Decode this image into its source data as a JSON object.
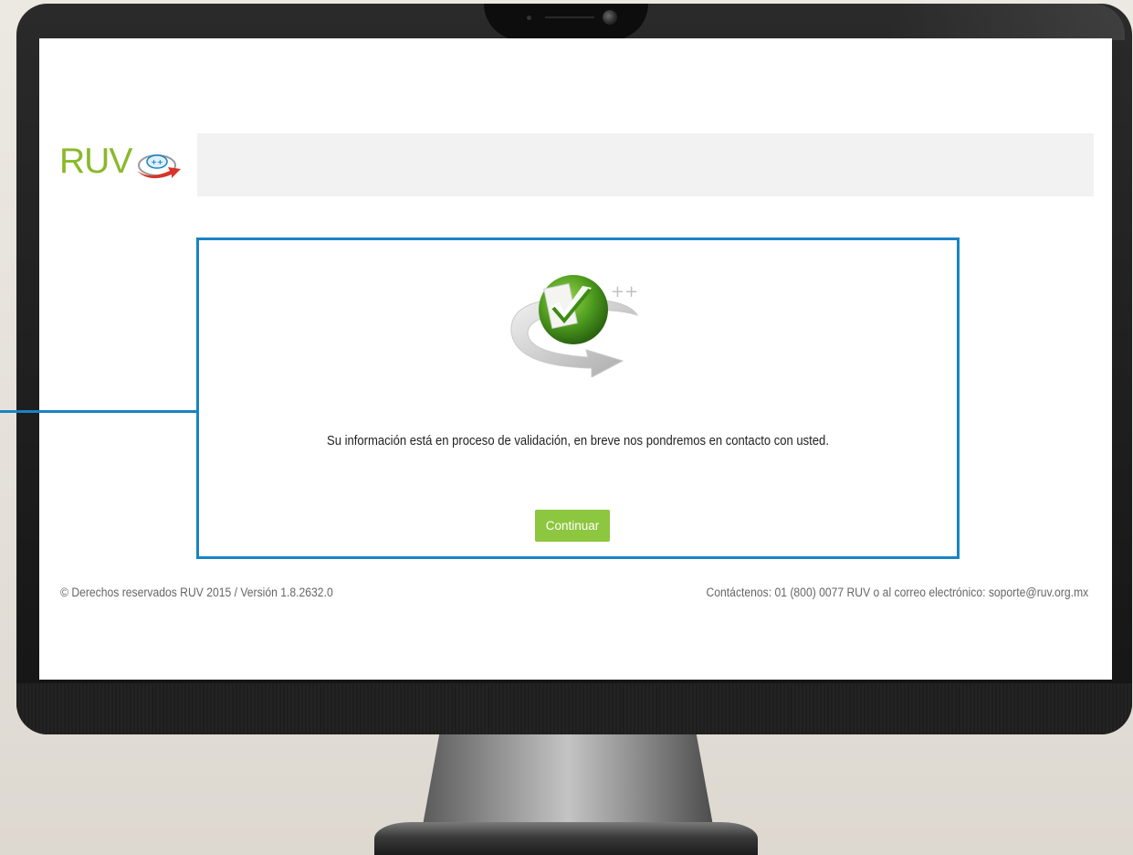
{
  "logo": {
    "text": "RUV",
    "badge_text": "++"
  },
  "modal": {
    "message": "Su información está en proceso de validación, en breve nos pondremos en contacto con usted.",
    "continue_label": "Continuar",
    "icon_badge": "++"
  },
  "footer": {
    "copyright": "© Derechos reservados RUV 2015 / Versión 1.8.2632.0",
    "contact": "Contáctenos: 01 (800) 0077 RUV o al correo electrónico: soporte@ruv.org.mx"
  },
  "colors": {
    "accent_blue": "#1a83c4",
    "brand_green": "#8ab82a",
    "button_green": "#8dc63f",
    "arrow_red": "#d8342a"
  },
  "icons": {
    "logo_mark": "red-circular-arrow-icon",
    "modal_icon": "green-checkmark-document-icon"
  }
}
